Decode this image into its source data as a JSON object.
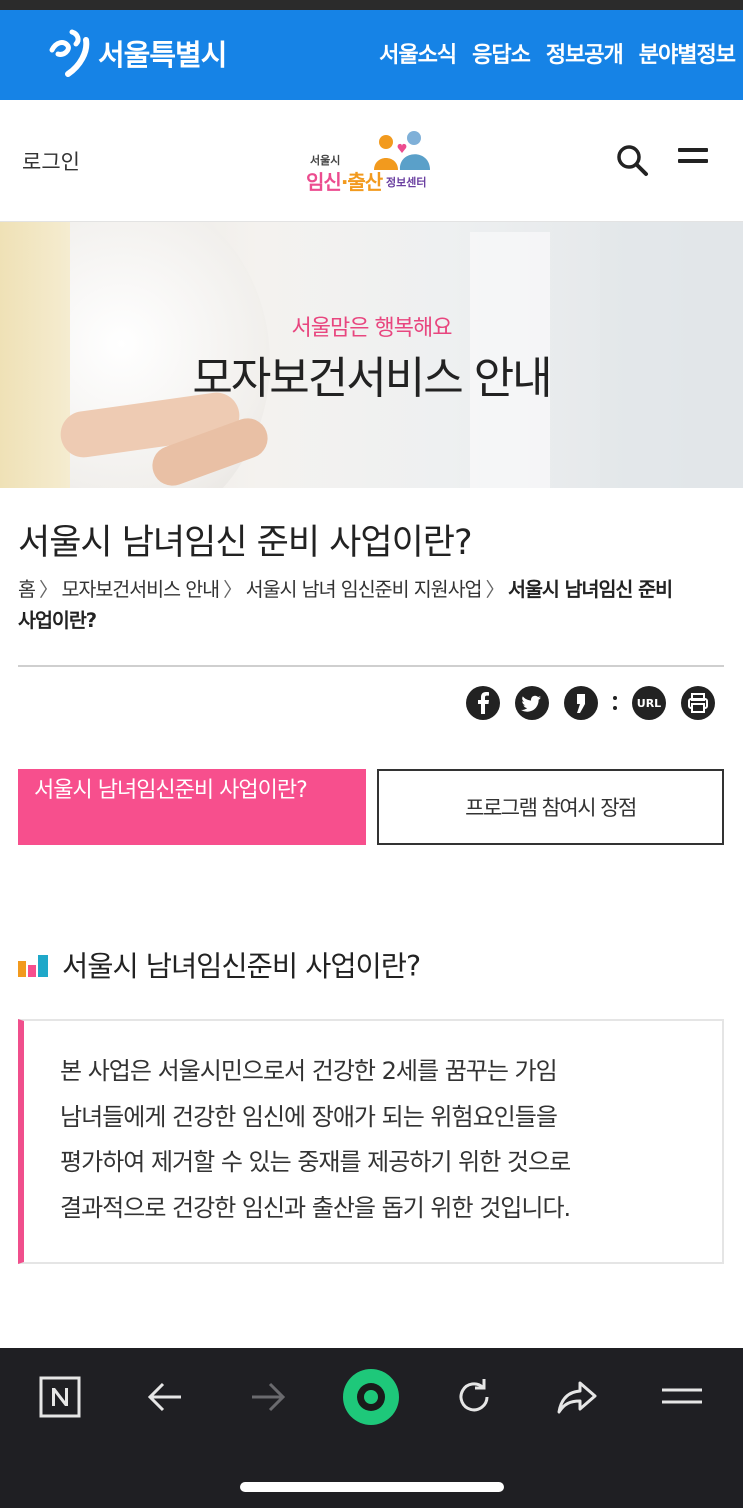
{
  "gov_bar": {
    "logo_text": "서울특별시",
    "nav": [
      "서울소식",
      "응답소",
      "정보공개",
      "분야별정보"
    ],
    "colors": {
      "background": "#1683e6"
    }
  },
  "site_header": {
    "login_label": "로그인",
    "logo": {
      "line1": "서울시",
      "line2a": "임신",
      "line2b": "·출산",
      "line3": "정보센터"
    },
    "icons": [
      "search-icon",
      "hamburger-menu-icon"
    ]
  },
  "banner": {
    "subtitle": "서울맘은 행복해요",
    "title": "모자보건서비스 안내"
  },
  "page": {
    "title": "서울시 남녀임신 준비 사업이란?",
    "breadcrumb": {
      "items": [
        "홈",
        "모자보건서비스 안내",
        "서울시 남녀 임신준비 지원사업"
      ],
      "current": "서울시 남녀임신 준비 사업이란?",
      "separator": "〉"
    },
    "share": {
      "url_label": "URL",
      "icons": [
        "facebook-icon",
        "twitter-icon",
        "kakaostory-icon",
        "more-dots-icon",
        "url-icon",
        "print-icon"
      ]
    }
  },
  "tabs": [
    {
      "label": "서울시 남녀임신준비 사업이란?",
      "active": true
    },
    {
      "label": "프로그램 참여시 장점",
      "active": false
    }
  ],
  "section": {
    "heading": "서울시 남녀임신준비 사업이란?",
    "paragraph_lines": [
      "본 사업은 서울시민으로서 건강한 2세를 꿈꾸는 가임",
      "남녀들에게 건강한 임신에 장애가 되는 위험요인들을",
      "평가하여 제거할 수 있는 중재를 제공하기 위한 것으로",
      "결과적으로 건강한 임신과 출산을 돕기 위한 것입니다."
    ],
    "colors": {
      "accent": "#f04f8c"
    }
  },
  "browser_toolbar": {
    "icons": [
      "naver-n-icon",
      "back-arrow-icon",
      "forward-arrow-icon",
      "green-dot-icon",
      "reload-icon",
      "share-icon",
      "menu-icon"
    ],
    "colors": {
      "background": "#1f1f23",
      "green": "#1ec800"
    }
  },
  "colors": {
    "pink": "#f74f8d",
    "blue": "#1683e6"
  }
}
